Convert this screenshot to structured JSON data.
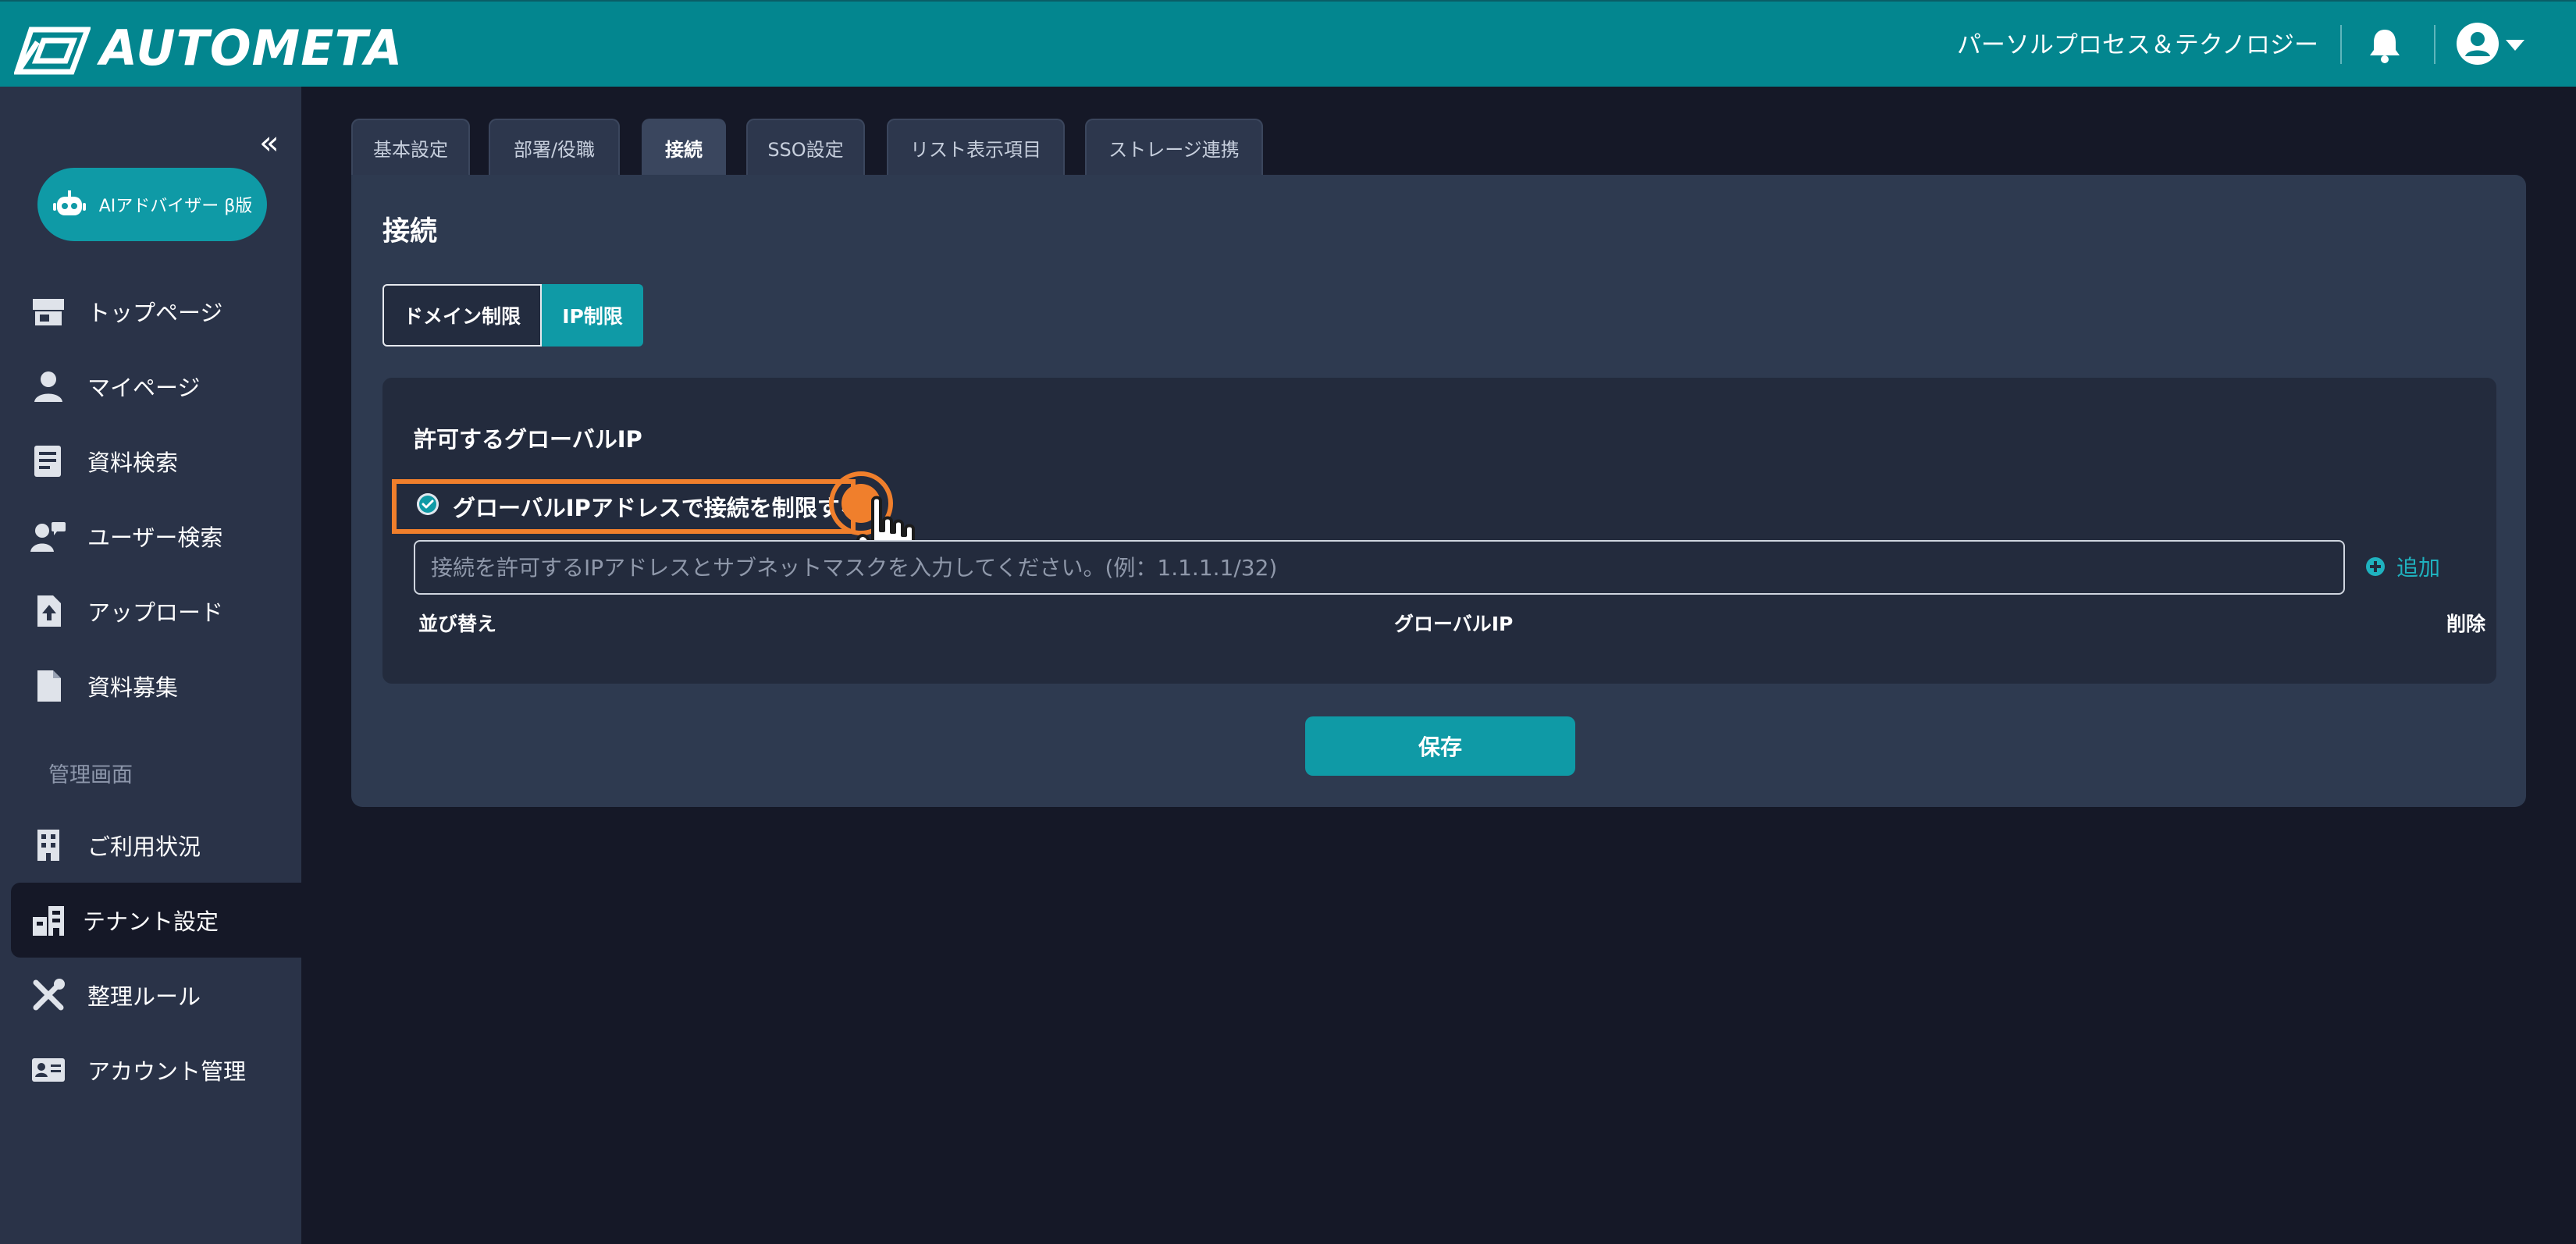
{
  "header": {
    "logo_text": "AUTOMETA",
    "organization": "パーソルプロセス＆テクノロジー",
    "icons": [
      "logo-icon",
      "bell-icon",
      "user-avatar-icon",
      "caret-down-icon"
    ]
  },
  "sidebar": {
    "collapse_symbol": "«",
    "ai_button": "AIアドバイザー β版",
    "items": [
      {
        "label": "トップページ",
        "icon": "store-icon"
      },
      {
        "label": "マイページ",
        "icon": "person-icon"
      },
      {
        "label": "資料検索",
        "icon": "document-list-icon"
      },
      {
        "label": "ユーザー検索",
        "icon": "user-search-icon"
      },
      {
        "label": "アップロード",
        "icon": "upload-file-icon"
      },
      {
        "label": "資料募集",
        "icon": "file-icon"
      }
    ],
    "admin_section_label": "管理画面",
    "admin_items": [
      {
        "label": "ご利用状況",
        "icon": "building-icon"
      },
      {
        "label": "テナント設定",
        "icon": "tenant-icon",
        "active": true
      },
      {
        "label": "整理ルール",
        "icon": "tools-icon"
      },
      {
        "label": "アカウント管理",
        "icon": "id-card-icon"
      }
    ]
  },
  "tabs": [
    {
      "label": "基本設定"
    },
    {
      "label": "部署/役職"
    },
    {
      "label": "接続",
      "active": true
    },
    {
      "label": "SSO設定"
    },
    {
      "label": "リスト表示項目"
    },
    {
      "label": "ストレージ連携"
    }
  ],
  "panel": {
    "title": "接続",
    "segments": {
      "domain": "ドメイン制限",
      "ip": "IP制限",
      "selected": "ip"
    },
    "section_title": "許可するグローバルIP",
    "checkbox_label": "グローバルIPアドレスで接続を制限する",
    "checkbox_checked": true,
    "input_placeholder": "接続を許可するIPアドレスとサブネットマスクを入力してください。(例：1.1.1.1/32)",
    "input_value": "",
    "add_label": "追加",
    "columns": [
      "並び替え",
      "グローバルIP",
      "削除"
    ],
    "save_label": "保存"
  },
  "colors": {
    "header": "#03868f",
    "accent": "#0f9aa6",
    "sidebar": "#2a3348",
    "background": "#151827",
    "panel": "#2e3a50",
    "highlight": "#f07f2c"
  }
}
